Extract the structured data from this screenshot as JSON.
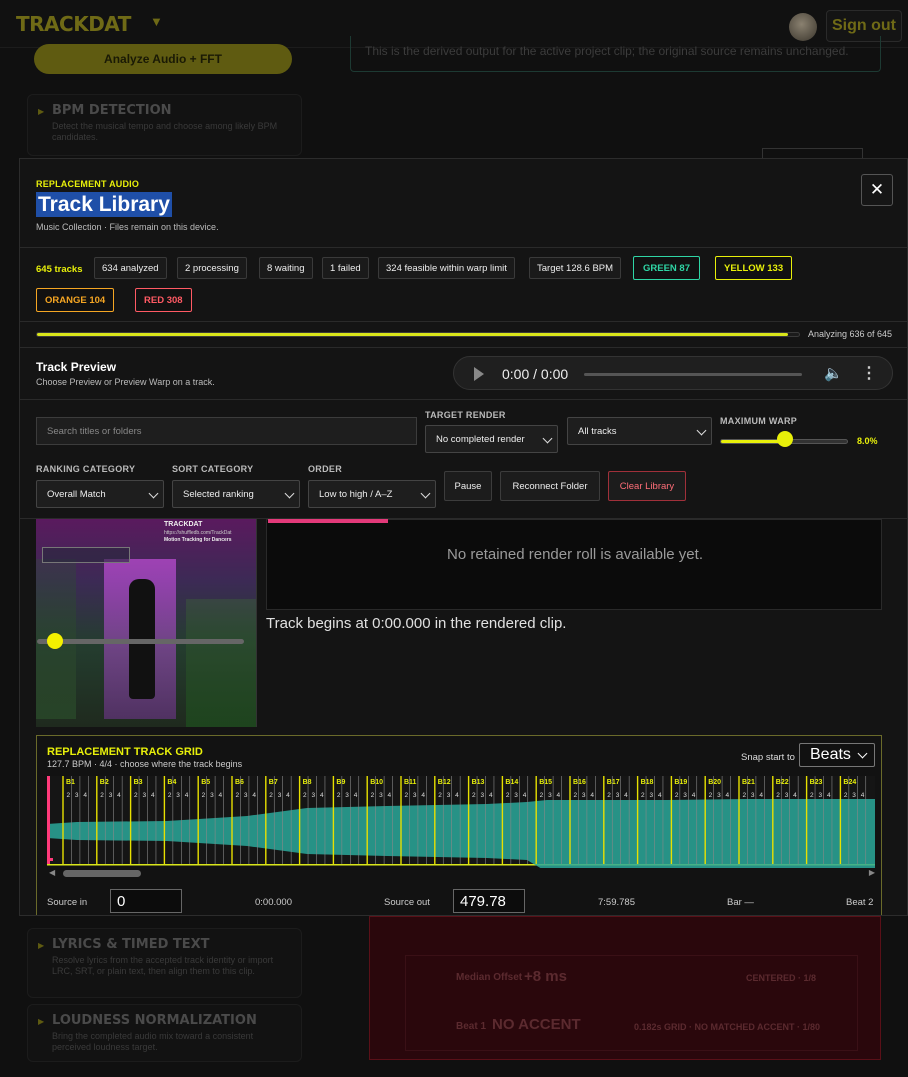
{
  "app": {
    "brand": "TRACKDAT",
    "sign_out": "Sign out",
    "analyze_button": "Analyze Audio + FFT",
    "derived_note": "This is the derived output for the active project clip; the original source remains unchanged.",
    "side_cards": [
      {
        "title": "BPM DETECTION",
        "desc": "Detect the musical tempo and choose among likely BPM candidates."
      },
      {
        "title": "LYRICS & TIMED TEXT",
        "desc": "Resolve lyrics from the accepted track identity or import LRC, SRT, or plain text, then align them to this clip."
      },
      {
        "title": "LOUDNESS NORMALIZATION",
        "desc": "Bring the completed audio mix toward a consistent perceived loudness target."
      }
    ],
    "bg_red": {
      "row1_label": "Median Offset",
      "row1_value": "+8 ms",
      "row1_right": "CENTERED · 1/8",
      "row2_label": "Beat 1",
      "row2_value": "NO ACCENT",
      "row2_right": "0.182s GRID · NO MATCHED ACCENT · 1/80"
    }
  },
  "modal": {
    "eyebrow": "REPLACEMENT AUDIO",
    "title": "Track Library",
    "subtitle": "Music Collection · Files remain on this device.",
    "close_glyph": "✕",
    "stats": {
      "tracks": "645 tracks",
      "analyzed": "634 analyzed",
      "processing": "2 processing",
      "waiting": "8 waiting",
      "failed": "1 failed",
      "feasible": "324 feasible within warp limit",
      "target": "Target 128.6 BPM",
      "green": "GREEN 87",
      "yellow": "YELLOW 133",
      "orange": "ORANGE 104",
      "red": "RED 308"
    },
    "colors": {
      "green": "#2fd5a5",
      "yellow": "#e8f00a",
      "orange": "#f5a623",
      "red": "#ff5a64",
      "accent": "#e8f00a"
    },
    "progress": {
      "fraction": 0.986,
      "label": "Analyzing 636 of 645"
    },
    "preview": {
      "title": "Track Preview",
      "subtitle": "Choose Preview or Preview Warp on a track.",
      "time": "0:00 / 0:00"
    },
    "filters": {
      "search_placeholder": "Search titles or folders",
      "target_render_label": "TARGET RENDER",
      "target_render_value": "No completed render",
      "tracks_value": "All tracks",
      "max_warp_label": "MAXIMUM WARP",
      "max_warp_value": "8.0%",
      "max_warp_fraction": 0.51,
      "ranking_label": "RANKING CATEGORY",
      "ranking_value": "Overall Match",
      "sort_label": "SORT CATEGORY",
      "sort_value": "Selected ranking",
      "order_label": "ORDER",
      "order_value": "Low to high / A–Z",
      "pause": "Pause",
      "reconnect": "Reconnect Folder",
      "clear": "Clear Library"
    },
    "video": {
      "brand": "TRACKDAT",
      "url": "https://shuffledb.com/TrackDat",
      "tag": "Motion Tracking for Dancers"
    },
    "render_roll": "No retained render roll is available yet.",
    "track_begins": "Track begins at 0:00.000 in the rendered clip.",
    "grid": {
      "title": "REPLACEMENT TRACK GRID",
      "subtitle": "127.7 BPM · 4/4 · choose where the track begins",
      "snap_label": "Snap start to",
      "snap_value": "Beats",
      "bars": [
        "B1",
        "B2",
        "B3",
        "B4",
        "B5",
        "B6",
        "B7",
        "B8",
        "B9",
        "B10",
        "B11",
        "B12",
        "B13",
        "B14",
        "B15",
        "B16",
        "B17",
        "B18",
        "B19",
        "B20",
        "B21",
        "B22",
        "B23",
        "B24"
      ],
      "beat_digits": [
        "2",
        "3",
        "4"
      ],
      "source_in_label": "Source in",
      "source_in_value": "0",
      "source_in_time": "0:00.000",
      "source_out_label": "Source out",
      "source_out_value": "479.78",
      "source_out_time": "7:59.785",
      "bar_readout": "Bar —",
      "beat_readout": "Beat 2"
    }
  }
}
